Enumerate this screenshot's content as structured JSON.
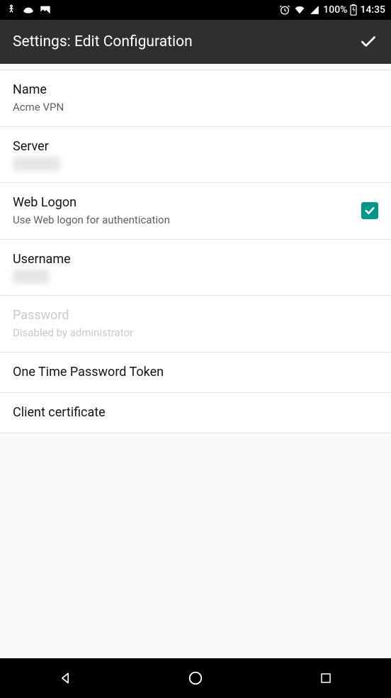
{
  "status": {
    "battery_pct": "100%",
    "time": "14:35"
  },
  "header": {
    "title": "Settings: Edit Configuration"
  },
  "fields": {
    "name": {
      "label": "Name",
      "value": "Acme VPN"
    },
    "server": {
      "label": "Server",
      "value": "xxxxxxxxx"
    },
    "web_logon": {
      "label": "Web Logon",
      "sub": "Use Web logon for authentication",
      "checked": true
    },
    "username": {
      "label": "Username",
      "value": "xxxxxxx"
    },
    "password": {
      "label": "Password",
      "sub": "Disabled by administrator"
    },
    "otp": {
      "label": "One Time Password Token"
    },
    "client_cert": {
      "label": "Client certificate"
    }
  },
  "colors": {
    "accent": "#009688"
  }
}
